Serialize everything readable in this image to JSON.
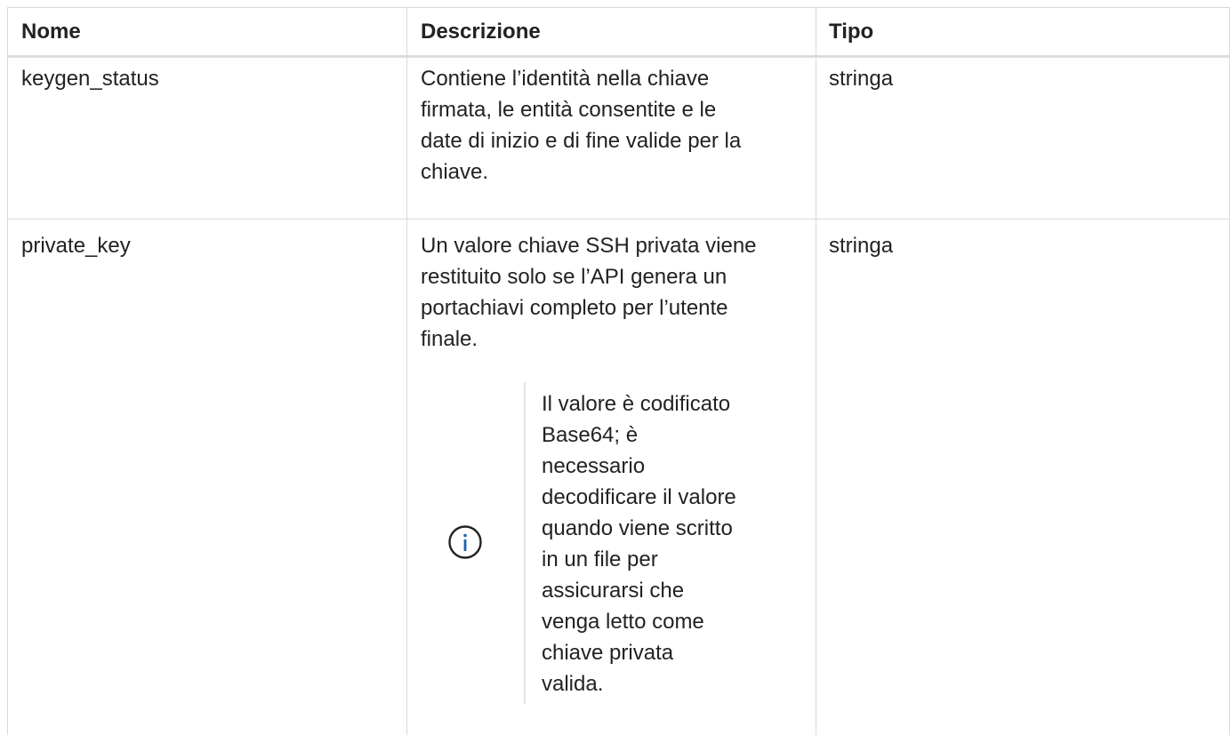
{
  "table": {
    "headers": {
      "name": "Nome",
      "description": "Descrizione",
      "type": "Tipo"
    },
    "rows": [
      {
        "name": "keygen_status",
        "description_lines": [
          "Contiene l’identità nella chiave",
          "firmata, le entità consentite e le",
          "date di inizio e di fine valide per la",
          "chiave."
        ],
        "type": "stringa"
      },
      {
        "name": "private_key",
        "description_lines": [
          "Un valore chiave SSH privata viene",
          "restituito solo se l’API genera un",
          "portachiavi completo per l’utente",
          "finale."
        ],
        "note": {
          "icon": "info-icon",
          "lines": [
            "Il valore è codificato",
            "Base64; è",
            "necessario",
            "decodificare il valore",
            "quando viene scritto",
            "in un file per",
            "assicurarsi che",
            "venga letto come",
            "chiave privata",
            "valida."
          ]
        },
        "type": "stringa"
      }
    ]
  },
  "colors": {
    "text": "#222222",
    "border": "#d9d9d9",
    "icon": "#1a63b3"
  }
}
